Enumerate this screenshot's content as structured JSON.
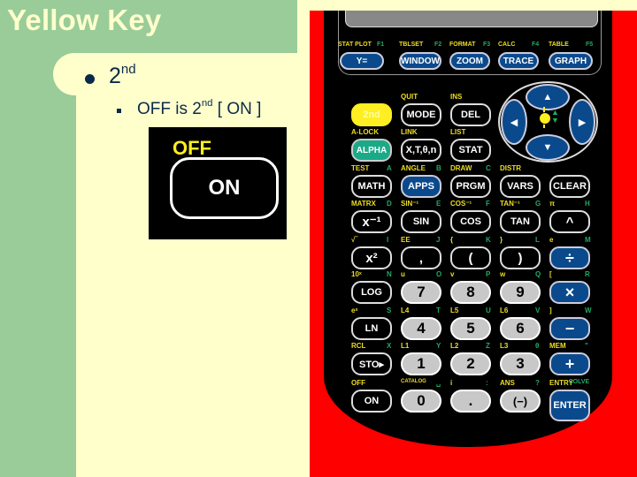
{
  "slide": {
    "title": "Yellow Key",
    "bullet_level1": {
      "text": "2",
      "superscript": "nd"
    },
    "bullet_level2": {
      "prefix": "OFF is 2",
      "superscript": "nd",
      "suffix": " [ ON ]"
    },
    "colors": {
      "accent_green": "#99cc99",
      "background_cream": "#ffffcc",
      "text_navy": "#0b2a4a"
    }
  },
  "on_key_image": {
    "secondary_label": "OFF",
    "key_label": "ON"
  },
  "calculator": {
    "function_row": [
      {
        "label": "Y=",
        "second": "STAT PLOT",
        "fn": "F1"
      },
      {
        "label": "WINDOW",
        "second": "TBLSET",
        "fn": "F2"
      },
      {
        "label": "ZOOM",
        "second": "FORMAT",
        "fn": "F3"
      },
      {
        "label": "TRACE",
        "second": "CALC",
        "fn": "F4"
      },
      {
        "label": "GRAPH",
        "second": "TABLE",
        "fn": "F5"
      }
    ],
    "row2": [
      {
        "label": "2nd",
        "second": "",
        "alpha": ""
      },
      {
        "label": "MODE",
        "second": "QUIT",
        "alpha": ""
      },
      {
        "label": "DEL",
        "second": "INS",
        "alpha": ""
      }
    ],
    "row3": [
      {
        "label": "ALPHA",
        "second": "A-LOCK",
        "alpha": ""
      },
      {
        "label": "X,T,θ,n",
        "second": "LINK",
        "alpha": ""
      },
      {
        "label": "STAT",
        "second": "LIST",
        "alpha": ""
      }
    ],
    "row4": [
      {
        "label": "MATH",
        "second": "TEST",
        "alpha": "A"
      },
      {
        "label": "APPS",
        "second": "ANGLE",
        "alpha": "B"
      },
      {
        "label": "PRGM",
        "second": "DRAW",
        "alpha": "C"
      },
      {
        "label": "VARS",
        "second": "DISTR",
        "alpha": ""
      },
      {
        "label": "CLEAR",
        "second": "",
        "alpha": ""
      }
    ],
    "row5": [
      {
        "label": "x⁻¹",
        "second": "MATRX",
        "alpha": "D"
      },
      {
        "label": "SIN",
        "second": "SIN⁻¹",
        "alpha": "E"
      },
      {
        "label": "COS",
        "second": "COS⁻¹",
        "alpha": "F"
      },
      {
        "label": "TAN",
        "second": "TAN⁻¹",
        "alpha": "G"
      },
      {
        "label": "^",
        "second": "π",
        "alpha": "H"
      }
    ],
    "row6": [
      {
        "label": "x²",
        "second": "√‾",
        "alpha": "I"
      },
      {
        "label": ",",
        "second": "EE",
        "alpha": "J"
      },
      {
        "label": "(",
        "second": "{",
        "alpha": "K"
      },
      {
        "label": ")",
        "second": "}",
        "alpha": "L"
      },
      {
        "label": "÷",
        "second": "e",
        "alpha": "M"
      }
    ],
    "row7": [
      {
        "label": "LOG",
        "second": "10ˣ",
        "alpha": "N"
      },
      {
        "label": "7",
        "second": "u",
        "alpha": "O"
      },
      {
        "label": "8",
        "second": "v",
        "alpha": "P"
      },
      {
        "label": "9",
        "second": "w",
        "alpha": "Q"
      },
      {
        "label": "×",
        "second": "[",
        "alpha": "R"
      }
    ],
    "row8": [
      {
        "label": "LN",
        "second": "eˣ",
        "alpha": "S"
      },
      {
        "label": "4",
        "second": "L4",
        "alpha": "T"
      },
      {
        "label": "5",
        "second": "L5",
        "alpha": "U"
      },
      {
        "label": "6",
        "second": "L6",
        "alpha": "V"
      },
      {
        "label": "−",
        "second": "]",
        "alpha": "W"
      }
    ],
    "row9": [
      {
        "label": "STO▸",
        "second": "RCL",
        "alpha": "X"
      },
      {
        "label": "1",
        "second": "L1",
        "alpha": "Y"
      },
      {
        "label": "2",
        "second": "L2",
        "alpha": "Z"
      },
      {
        "label": "3",
        "second": "L3",
        "alpha": "θ"
      },
      {
        "label": "+",
        "second": "MEM",
        "alpha": "\""
      }
    ],
    "row10": [
      {
        "label": "ON",
        "second": "OFF",
        "alpha": ""
      },
      {
        "label": "0",
        "second": "CATALOG",
        "alpha": "␣"
      },
      {
        "label": ".",
        "second": "i",
        "alpha": ":"
      },
      {
        "label": "(−)",
        "second": "ANS",
        "alpha": "?"
      },
      {
        "label": "ENTER",
        "second": "ENTRY",
        "alpha": "SOLVE"
      }
    ],
    "arrows": {
      "up": "▲",
      "down": "▼",
      "left": "◀",
      "right": "▶"
    }
  }
}
